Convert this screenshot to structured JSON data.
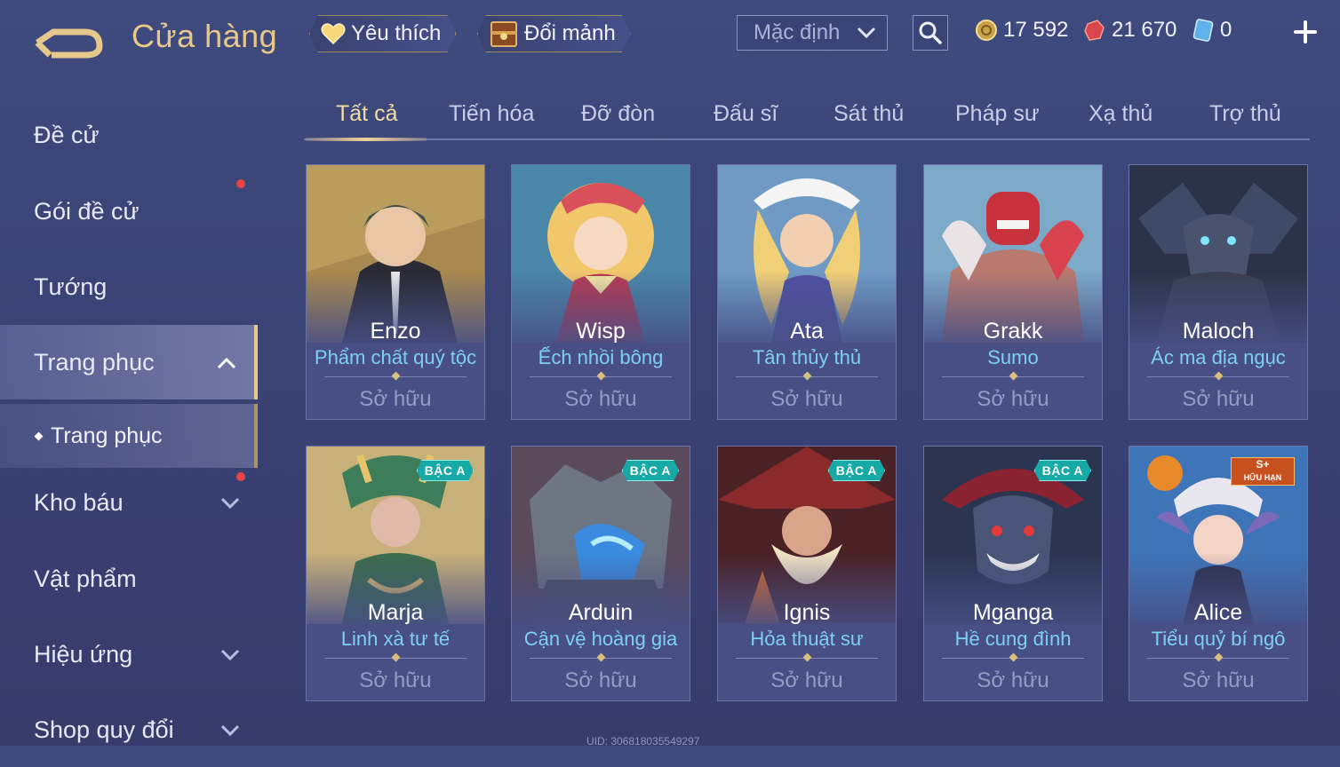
{
  "header": {
    "title": "Cửa hàng",
    "favorite_label": "Yêu thích",
    "swap_label": "Đổi mảnh",
    "sort_value": "Mặc định",
    "currencies": [
      {
        "name": "gold-coin",
        "value": "17 592"
      },
      {
        "name": "ruby",
        "value": "21 670"
      },
      {
        "name": "voucher",
        "value": "0"
      }
    ]
  },
  "sidebar": {
    "items": [
      {
        "label": "Đề cử"
      },
      {
        "label": "Gói đề cử"
      },
      {
        "label": "Tướng"
      },
      {
        "label": "Trang phục"
      },
      {
        "label": "Kho báu"
      },
      {
        "label": "Vật phẩm"
      },
      {
        "label": "Hiệu ứng"
      },
      {
        "label": "Shop quy đổi"
      }
    ],
    "sub_item": "Trang phục"
  },
  "tabs": [
    "Tất cả",
    "Tiến hóa",
    "Đỡ đòn",
    "Đấu sĩ",
    "Sát thủ",
    "Pháp sư",
    "Xạ thủ",
    "Trợ thủ"
  ],
  "cards": [
    {
      "hero": "Enzo",
      "skin": "Phẩm chất quý tộc",
      "status": "Sở hữu",
      "badge": ""
    },
    {
      "hero": "Wisp",
      "skin": "Ếch nhồi bông",
      "status": "Sở hữu",
      "badge": ""
    },
    {
      "hero": "Ata",
      "skin": "Tân thủy thủ",
      "status": "Sở hữu",
      "badge": ""
    },
    {
      "hero": "Grakk",
      "skin": "Sumo",
      "status": "Sở hữu",
      "badge": ""
    },
    {
      "hero": "Maloch",
      "skin": "Ác ma địa ngục",
      "status": "Sở hữu",
      "badge": ""
    },
    {
      "hero": "Marja",
      "skin": "Linh xà tư tế",
      "status": "Sở hữu",
      "badge": "BẬC A"
    },
    {
      "hero": "Arduin",
      "skin": "Cận vệ hoàng gia",
      "status": "Sở hữu",
      "badge": "BẬC A"
    },
    {
      "hero": "Ignis",
      "skin": "Hỏa thuật sư",
      "status": "Sở hữu",
      "badge": "BẬC A"
    },
    {
      "hero": "Mganga",
      "skin": "Hề cung đình",
      "status": "Sở hữu",
      "badge": "BẬC A"
    },
    {
      "hero": "Alice",
      "skin": "Tiểu quỷ bí ngô",
      "status": "Sở hữu",
      "badge": "S+",
      "badge_sub": "HỮU HẠN"
    }
  ],
  "uid": "UID: 306818035549297",
  "colors": {
    "accent_gold": "#e8c98a",
    "skin_name": "#7fd0f0",
    "notification": "#e64646"
  }
}
